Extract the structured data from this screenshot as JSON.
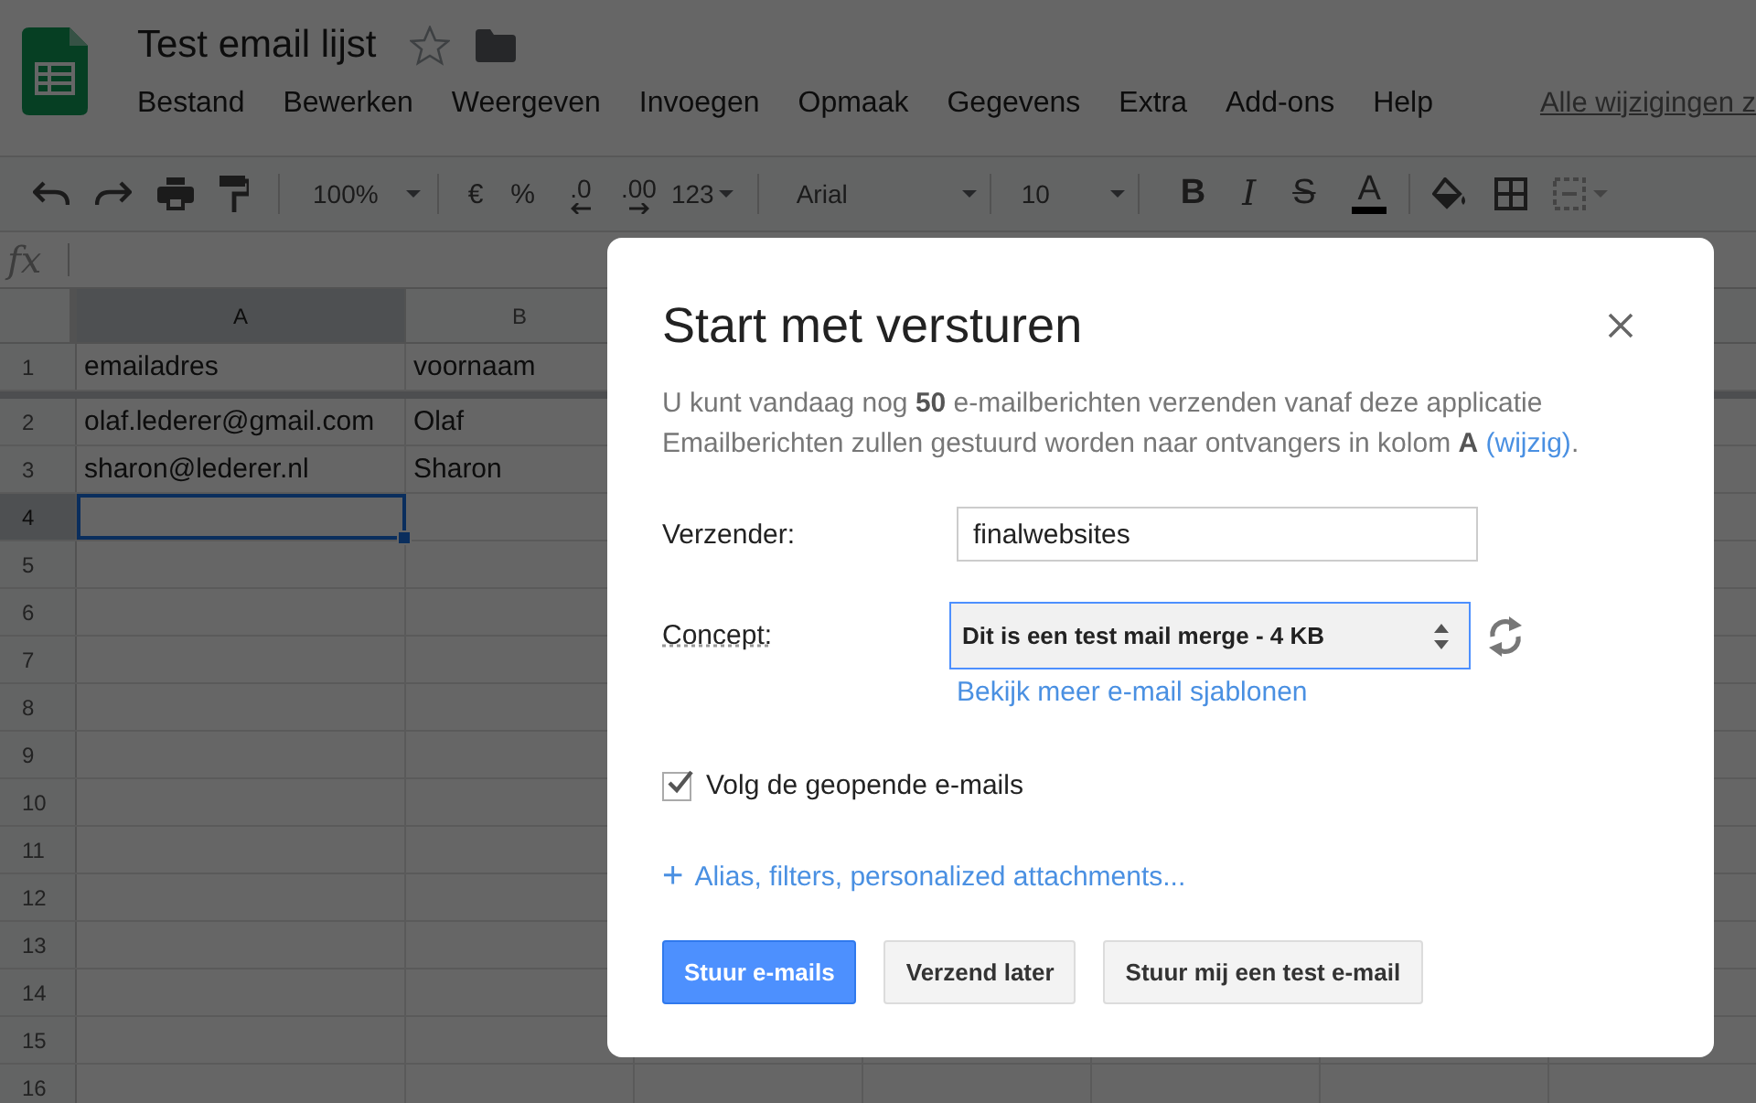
{
  "app": {
    "title": "Test email lijst",
    "starred": false,
    "menu": [
      "Bestand",
      "Bewerken",
      "Weergeven",
      "Invoegen",
      "Opmaak",
      "Gegevens",
      "Extra",
      "Add-ons",
      "Help"
    ],
    "save_status": "Alle wijzigingen z"
  },
  "toolbar": {
    "zoom": "100%",
    "currency": "€",
    "percent": "%",
    "decrease_decimals": ".0",
    "increase_decimals": ".00",
    "number_format": "123",
    "font": "Arial",
    "font_size": "10",
    "format_buttons": [
      {
        "label": "B",
        "kind": "bold"
      },
      {
        "label": "I",
        "kind": "italic"
      },
      {
        "label": "S",
        "kind": "strike"
      },
      {
        "label": "A",
        "kind": "color"
      }
    ]
  },
  "formula_bar": {
    "label": "fx"
  },
  "sheet": {
    "columns": [
      {
        "label": "A",
        "selected": true
      },
      {
        "label": "B",
        "selected": false
      }
    ],
    "rows": [
      {
        "number": "1",
        "cells": [
          "emailadres",
          "voornaam"
        ],
        "selected": false
      },
      {
        "number": "2",
        "cells": [
          "olaf.lederer@gmail.com",
          "Olaf"
        ],
        "selected": false
      },
      {
        "number": "3",
        "cells": [
          "sharon@lederer.nl",
          "Sharon"
        ],
        "selected": false
      },
      {
        "number": "4",
        "selected": true
      },
      {
        "number": "5",
        "selected": false
      },
      {
        "number": "6",
        "selected": false
      },
      {
        "number": "7",
        "selected": false
      },
      {
        "number": "8",
        "selected": false
      },
      {
        "number": "9",
        "selected": false
      },
      {
        "number": "10",
        "selected": false
      },
      {
        "number": "11",
        "selected": false
      },
      {
        "number": "12",
        "selected": false
      },
      {
        "number": "13",
        "selected": false
      },
      {
        "number": "14",
        "selected": false
      },
      {
        "number": "15",
        "selected": false
      },
      {
        "number": "16",
        "selected": false
      }
    ]
  },
  "dialog": {
    "title": "Start met versturen",
    "intro": "U kunt vandaag nog **50** e-mailberichten verzenden vanaf deze applicatie",
    "column_note": {
      "text": "Emailberichten zullen gestuurd worden naar ontvangers in kolom **A**",
      "link": "(wijzig)",
      "end": "."
    },
    "sender": {
      "label": "Verzender:",
      "value": "finalwebsites"
    },
    "draft": {
      "label": "Concept:",
      "value": "Dit is een test mail merge - 4 KB",
      "link": "Bekijk meer e-mail sjablonen"
    },
    "track_opens": {
      "label": "Volg de geopende e-mails",
      "checked": true
    },
    "advanced": {
      "icon": "+",
      "label": "Alias, filters, personalized attachments..."
    },
    "buttons": [
      {
        "label": "Stuur e-mails",
        "kind": "primary"
      },
      {
        "label": "Verzend later",
        "kind": "secondary"
      },
      {
        "label": "Stuur mij een test e-mail",
        "kind": "secondary"
      }
    ]
  }
}
